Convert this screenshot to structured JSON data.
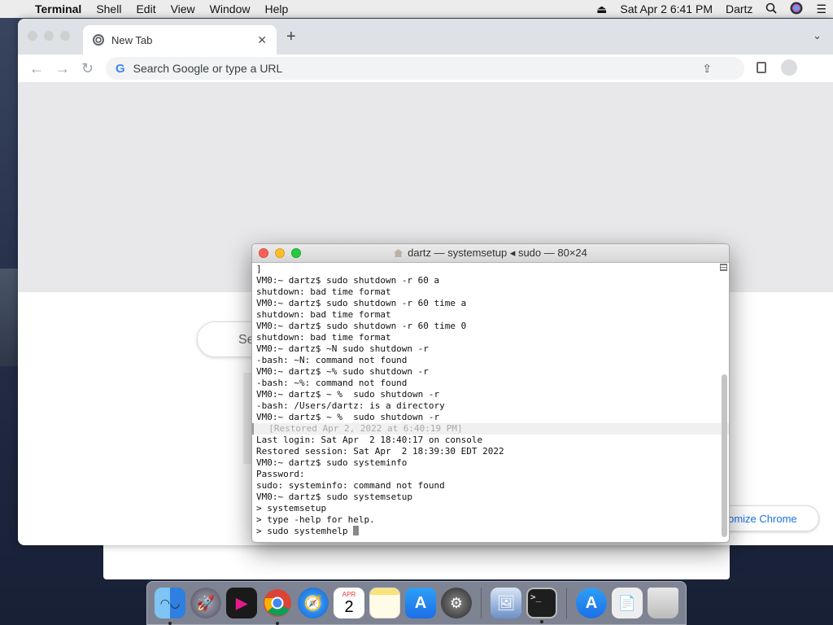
{
  "menubar": {
    "app_name": "Terminal",
    "menus": [
      "Shell",
      "Edit",
      "View",
      "Window",
      "Help"
    ],
    "datetime": "Sat Apr 2  6:41 PM",
    "user": "Dartz"
  },
  "chrome": {
    "tab_title": "New Tab",
    "omnibox_placeholder": "Search Google or type a URL",
    "search_box_partial": "Se",
    "customize_label": "stomize Chrome"
  },
  "terminal": {
    "title": "dartz — systemsetup ◂ sudo — 80×24",
    "lines": [
      "]",
      "VM0:~ dartz$ sudo shutdown -r 60 a",
      "shutdown: bad time format",
      "VM0:~ dartz$ sudo shutdown -r 60 time a",
      "shutdown: bad time format",
      "VM0:~ dartz$ sudo shutdown -r 60 time 0",
      "shutdown: bad time format",
      "VM0:~ dartz$ ~N sudo shutdown -r",
      "-bash: ~N: command not found",
      "VM0:~ dartz$ ~% sudo shutdown -r",
      "-bash: ~%: command not found",
      "VM0:~ dartz$ ~ %  sudo shutdown -r",
      "-bash: /Users/dartz: is a directory",
      "VM0:~ dartz$ ~ %  sudo shutdown -r",
      "  [Restored Apr 2, 2022 at 6:40:19 PM]",
      "Last login: Sat Apr  2 18:40:17 on console",
      "Restored session: Sat Apr  2 18:39:30 EDT 2022",
      "VM0:~ dartz$ sudo systeminfo",
      "Password:",
      "sudo: systeminfo: command not found",
      "VM0:~ dartz$ sudo systemsetup",
      "> systemsetup",
      "> type -help for help.",
      "> sudo systemhelp "
    ]
  },
  "dock": {
    "calendar_month": "APR",
    "calendar_day": "2",
    "terminal_prompt": ">_"
  }
}
